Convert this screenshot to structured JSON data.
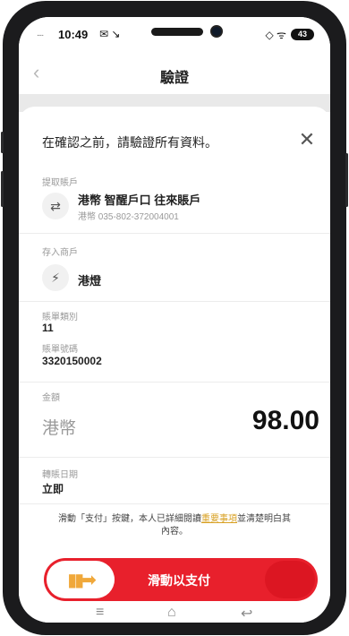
{
  "status_bar": {
    "dots": "....",
    "time": "10:49",
    "left_icons": "✉ ↘",
    "right_icons": "◇ ᯤ",
    "battery": "43"
  },
  "header": {
    "back_icon": "chevron-left-icon",
    "title": "驗證"
  },
  "sheet": {
    "title": "在確認之前，請驗證所有資料。",
    "close_label": "✕"
  },
  "from_account": {
    "label": "提取賬戶",
    "icon": "transfer-arrows-icon",
    "name": "港幣 智醒戶口 往來賬戶",
    "number": "港幣 035-802-372004001"
  },
  "merchant": {
    "label": "存入商戶",
    "icon": "power-tower-icon",
    "name": "港燈"
  },
  "bill": {
    "type_label": "賬單類別",
    "type_value": "11",
    "number_label": "賬單號碼",
    "number_value": "3320150002"
  },
  "amount": {
    "label": "金額",
    "currency": "港幣",
    "value": "98.00"
  },
  "transfer_date": {
    "label": "轉賬日期",
    "value": "立即"
  },
  "disclaimer": {
    "before": "滑動「支付」按鍵，本人已詳細閱讀",
    "link": "重要事項",
    "after": "並清楚明白其內容。"
  },
  "slider": {
    "label": "滑動以支付",
    "arrow": "▮▮➡"
  },
  "system_nav": {
    "menu": "≡",
    "home": "⌂",
    "back": "↩"
  },
  "colors": {
    "brand_red": "#e8202c",
    "link_gold": "#d8a022"
  }
}
